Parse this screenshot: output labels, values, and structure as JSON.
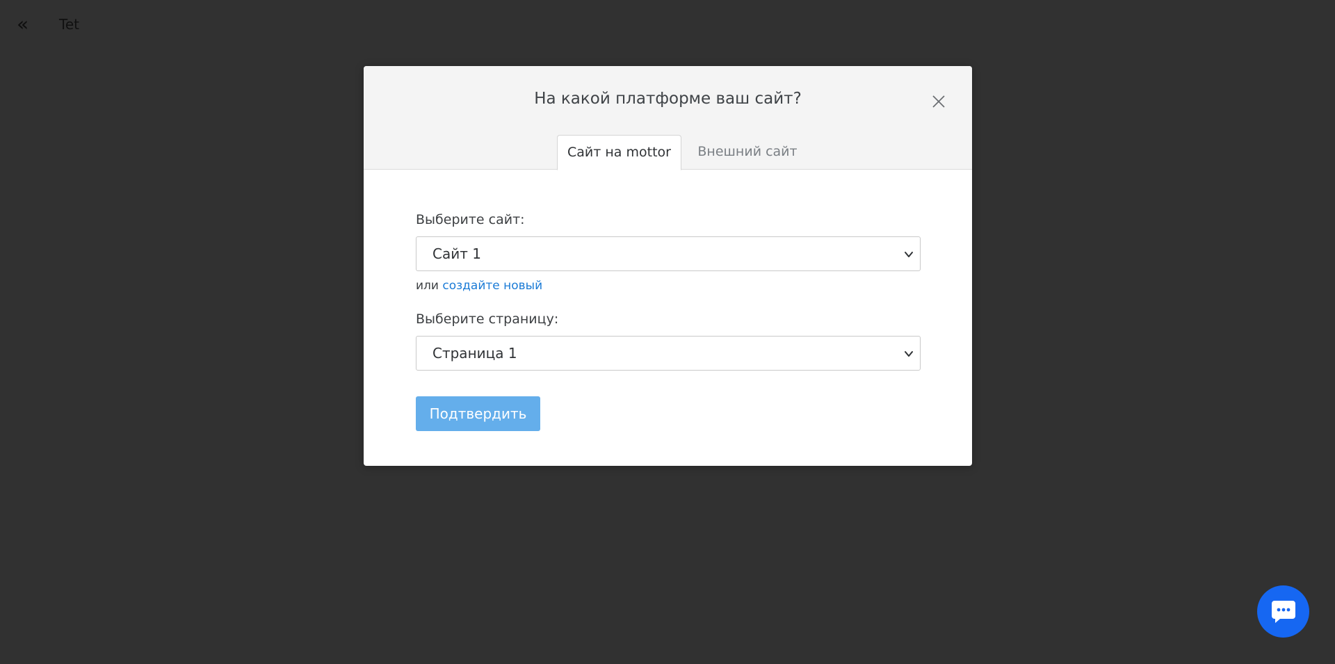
{
  "top_bar": {
    "back_label": "«",
    "project_title": "Tet"
  },
  "modal": {
    "title": "На какой платформе ваш сайт?",
    "close_icon": "close-icon",
    "tabs": [
      {
        "label": "Сайт на mottor",
        "active": true
      },
      {
        "label": "Внешний сайт",
        "active": false
      }
    ],
    "site_field": {
      "label": "Выберите сайт:",
      "selected_value": "Сайт 1"
    },
    "or_text": "или",
    "create_link_label": "создайте новый",
    "page_field": {
      "label": "Выберите страницу:",
      "selected_value": "Страница 1"
    },
    "confirm_label": "Подтвердить"
  },
  "chat_widget": {
    "icon": "chat-icon"
  },
  "colors": {
    "background": "#313131",
    "accent": "#64aeeb",
    "link": "#1b7bd6",
    "chat": "#1667f2"
  }
}
